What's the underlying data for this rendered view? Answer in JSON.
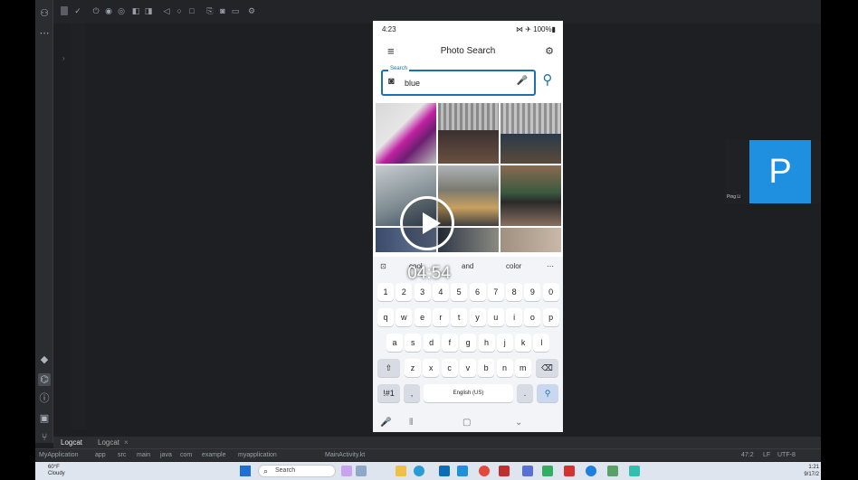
{
  "phone": {
    "status_time": "4:23",
    "status_right": "⋈ ✈ 100%▮",
    "title": "Photo Search",
    "search_label": "Search",
    "search_value": "blue",
    "suggestions": [
      "cool",
      "and",
      "color"
    ],
    "keys_numbers": [
      "1",
      "2",
      "3",
      "4",
      "5",
      "6",
      "7",
      "8",
      "9",
      "0"
    ],
    "keys_row1": [
      "q",
      "w",
      "e",
      "r",
      "t",
      "y",
      "u",
      "i",
      "o",
      "p"
    ],
    "keys_row2": [
      "a",
      "s",
      "d",
      "f",
      "g",
      "h",
      "j",
      "k",
      "l"
    ],
    "keys_row3": [
      "z",
      "x",
      "c",
      "v",
      "b",
      "n",
      "m"
    ],
    "key_symbols": "!#1",
    "key_comma": ",",
    "key_space": "English (US)",
    "key_period": "."
  },
  "video": {
    "time": "04:54"
  },
  "ide": {
    "tab_logcat_1": "Logcat",
    "tab_logcat_2": "Logcat",
    "breadcrumb": [
      "MyApplication",
      "app",
      "src",
      "main",
      "java",
      "com",
      "example",
      "myapplication",
      "MainActivity.kt"
    ],
    "cursor_pos": "47:2",
    "line_sep": "LF",
    "encoding": "UTF-8"
  },
  "participant": {
    "initial": "P",
    "name": "Ping Li"
  },
  "taskbar": {
    "temp": "60°F",
    "condition": "Cloudy",
    "search_placeholder": "Search",
    "time": "1:21",
    "date": "9/17/2"
  },
  "colors": {
    "accent": "#1d6fb0",
    "ide_bg": "#1e1f22",
    "avatar_bg": "#1f8fdf"
  }
}
